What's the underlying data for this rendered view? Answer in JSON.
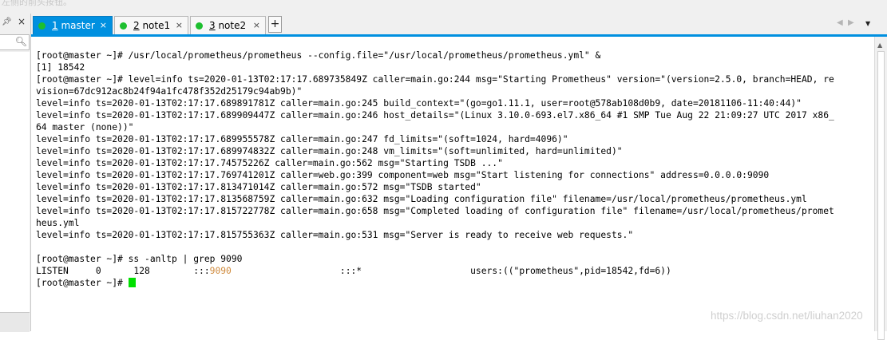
{
  "top_strip_text": "左侧的前头按钮。",
  "left_panel": {
    "pin_icon": "pin-icon",
    "close_icon": "close-icon",
    "search_icon": "search-icon"
  },
  "tabs": [
    {
      "number": "1",
      "name": " master",
      "close": "×",
      "active": true
    },
    {
      "number": "2",
      "name": " note1",
      "close": "×",
      "active": false
    },
    {
      "number": "3",
      "name": " note2",
      "close": "×",
      "active": false
    }
  ],
  "tab_controls": {
    "add": "+",
    "prev": "◀",
    "next": "▶",
    "menu": "▼"
  },
  "colors": {
    "accent": "#0090e0",
    "status_dot": "#1dbf2f",
    "cursor": "#00e000",
    "port_highlight": "#cf8a3c"
  },
  "terminal": {
    "lines": [
      "[root@master ~]# /usr/local/prometheus/prometheus --config.file=\"/usr/local/prometheus/prometheus.yml\" &",
      "[1] 18542",
      "[root@master ~]# level=info ts=2020-01-13T02:17:17.689735849Z caller=main.go:244 msg=\"Starting Prometheus\" version=\"(version=2.5.0, branch=HEAD, re",
      "vision=67dc912ac8b24f94a1fc478f352d25179c94ab9b)\"",
      "level=info ts=2020-01-13T02:17:17.689891781Z caller=main.go:245 build_context=\"(go=go1.11.1, user=root@578ab108d0b9, date=20181106-11:40:44)\"",
      "level=info ts=2020-01-13T02:17:17.689909447Z caller=main.go:246 host_details=\"(Linux 3.10.0-693.el7.x86_64 #1 SMP Tue Aug 22 21:09:27 UTC 2017 x86_",
      "64 master (none))\"",
      "level=info ts=2020-01-13T02:17:17.689955578Z caller=main.go:247 fd_limits=\"(soft=1024, hard=4096)\"",
      "level=info ts=2020-01-13T02:17:17.689974832Z caller=main.go:248 vm_limits=\"(soft=unlimited, hard=unlimited)\"",
      "level=info ts=2020-01-13T02:17:17.74575226Z caller=main.go:562 msg=\"Starting TSDB ...\"",
      "level=info ts=2020-01-13T02:17:17.769741201Z caller=web.go:399 component=web msg=\"Start listening for connections\" address=0.0.0.0:9090",
      "level=info ts=2020-01-13T02:17:17.813471014Z caller=main.go:572 msg=\"TSDB started\"",
      "level=info ts=2020-01-13T02:17:17.813568759Z caller=main.go:632 msg=\"Loading configuration file\" filename=/usr/local/prometheus/prometheus.yml",
      "level=info ts=2020-01-13T02:17:17.815722778Z caller=main.go:658 msg=\"Completed loading of configuration file\" filename=/usr/local/prometheus/promet",
      "heus.yml",
      "level=info ts=2020-01-13T02:17:17.815755363Z caller=main.go:531 msg=\"Server is ready to receive web requests.\"",
      "",
      "[root@master ~]# ss -anltp | grep 9090"
    ],
    "listen_line": {
      "pre": "LISTEN     0      128        :::",
      "port": "9090",
      "post": "                    :::*                    users:((\"prometheus\",pid=18542,fd=6))"
    },
    "prompt": "[root@master ~]# "
  },
  "watermark": "https://blog.csdn.net/liuhan2020"
}
